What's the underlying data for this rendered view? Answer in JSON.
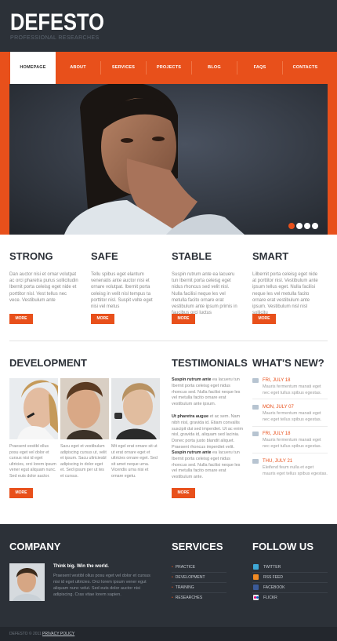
{
  "brand": {
    "title": "DEFESTO",
    "subtitle": "PROFESSIONAL RESEARCHES"
  },
  "nav": [
    "HOMEPAGE",
    "ABOUT",
    "SERVICES",
    "PROJECTS",
    "BLOG",
    "FAQS",
    "CONTACTS"
  ],
  "columns": [
    {
      "title": "STRONG",
      "text": "Dan auctor nisi et ornar volutpat ac orci pharetra purus sollicitudin Ibernit porta celeisg eget nide et porttitor nisl. Vest tellus nec vece. Vestibulum ante",
      "more": "MORE"
    },
    {
      "title": "SAFE",
      "text": "Tellu spibus eget elantum venenatis ante auctor nisi et ornare volutpat. Ibernit porta celeisg in velit nisl tempus ta porttitor nisl. Suspit volte eget nisi vel metus",
      "more": "MORE"
    },
    {
      "title": "STABLE",
      "text": "Suspin rutrum ante ea lacueru tun Ibernit porta celeisg eget nidus rhoncus sed velit nisl. Nulla facilisi neque les vel metulla facito ornare erat vestibulum ante ipsum primis in faucibus orci luctus",
      "more": "MORE"
    },
    {
      "title": "SMART",
      "text": "Lilbernit porta celeisg eget nide at porttitor nisl. Vestibulum ante ipsum tellus eget. Nulla facilisi neque les vel metulla facito ornare erat vestibulum ante ipsum. Vestibulum nisl nisl sollicitu",
      "more": "MORE"
    }
  ],
  "development": {
    "title": "DEVELOPMENT",
    "texts": [
      "Praesent vestibl ollus posu eget vel dolor et cursus nisi id eget ultricies, orci lorem ipsum vener egut aliquam nunc. Sed euts dolor auctor.",
      "Sacu eget et vestibulum adipiscing cursus ut, velit et ipsum. Sacu ultriciesbl adipiscing in dolor eget et. Sed ipsum per ut tes et cursus.",
      "Mit egel erat ornare sit ut ut erat ornare eget et ultricies ornare eget. Sed sit amet neque urna. Vicendis urna nisi et ornare egetu."
    ],
    "more": "MORE"
  },
  "testimonials": {
    "title": "TESTIMONIALS",
    "items": [
      {
        "lead": "Suspin rutrum ante",
        "text": "ea lacueru tun Ibernit porta celeisg eget nidus rhoncus sed. Nulla facilisi neque les vel metulla facito ornare erat vestibulum ante ipsum."
      },
      {
        "lead": "Ut pharetra augue",
        "text": "et ac sem. Nam nibh nisl, gravida id. Etiam convallis suscipit dui sed imperdiet. Ut ac enim nisl, gravida id, aliquam sed lacinia. Donec porta justo blandit aliquet. Praesent rhoncus imperdiet velit."
      },
      {
        "lead": "Suspin rutrum ante",
        "text": "ea lacueru tun Ibernit porta celeisg eget nidus rhoncus sed. Nulla facilisi neque les vel metulla facito ornare erat vestibulum ante."
      }
    ],
    "more": "MORE"
  },
  "news": {
    "title": "WHAT'S NEW?",
    "items": [
      {
        "date": "FRI, JULY 18",
        "text": "Mauris fermentum manati eget nec eget tullus spibus egestas."
      },
      {
        "date": "MON, JULY 07",
        "text": "Mauris fermentum manati eget nec eget tellus spibus egestas."
      },
      {
        "date": "FRI, JULY 18",
        "text": "Mauris fermentum manati eget nec eget tullus spibus egestas."
      },
      {
        "date": "THU, JULY 21",
        "text": "Eleifend feum nulla et eget mauris eget tellus spibus egestas."
      }
    ]
  },
  "footer": {
    "company_title": "COMPANY",
    "company_lead": "Think big. Win the world.",
    "company_text": "Praesent vestibl ollus posu eget vel dolor et cursus nisi id eget ultricies. Orci lorem ipsum vener egut aliquam nunc velut. Sed euts dolor auctor nisi adipiscing. Cras vitae lorem sapien.",
    "services_title": "SERVICES",
    "services": [
      "PRACTICE",
      "DEVELOPMENT",
      "TRAINING",
      "RESEARCHES"
    ],
    "follow_title": "FOLLOW US",
    "follow": [
      "TWITTER",
      "RSS FEED",
      "FACEBOOK",
      "FLICKR"
    ],
    "copyright": "DEFESTO © 2011 ·",
    "policy": "PRIVACY POLICY",
    "colors": {
      "accent": "#e8501b",
      "dark": "#2c3138"
    }
  }
}
